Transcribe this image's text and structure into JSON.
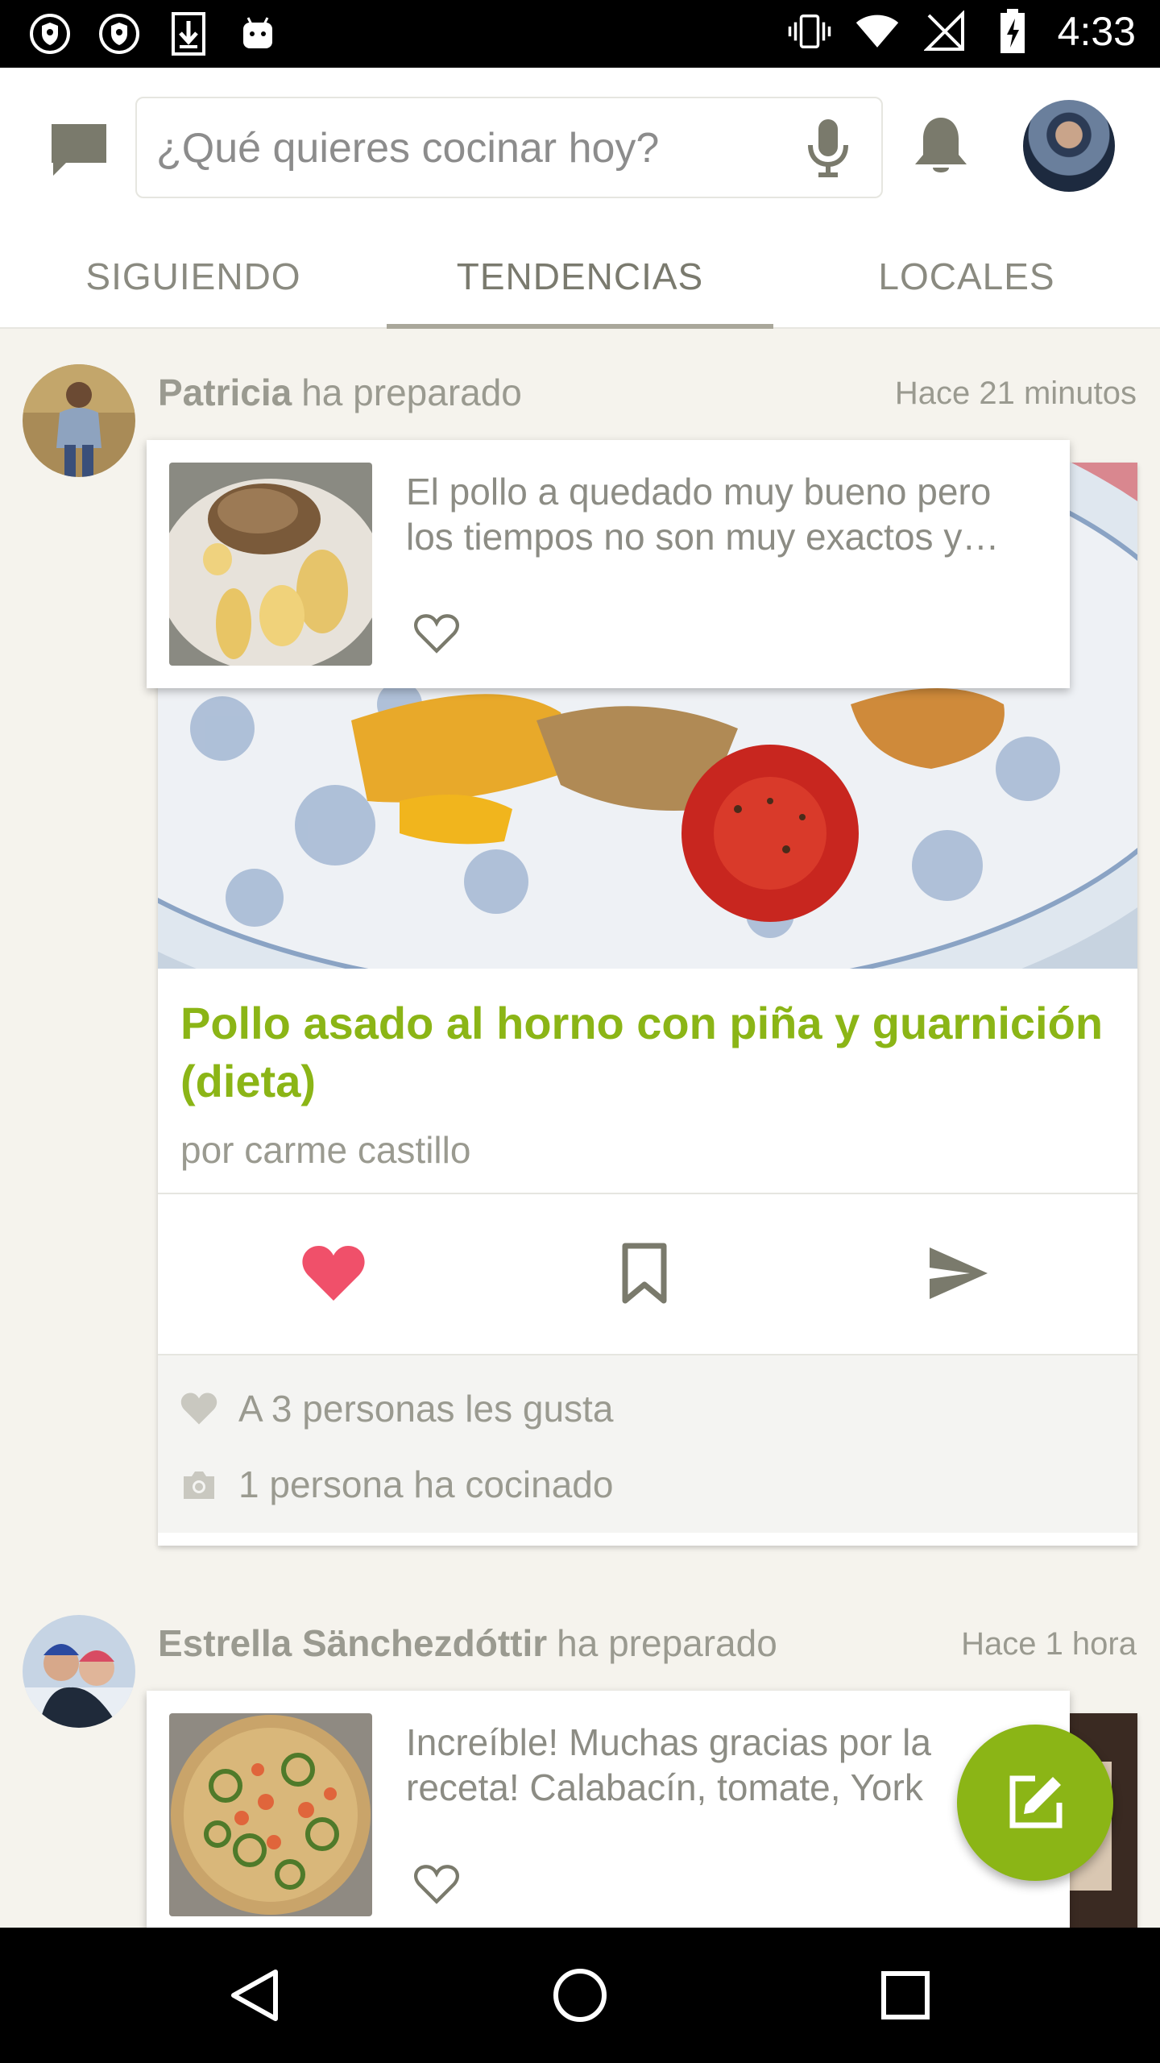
{
  "status_bar": {
    "time": "4:33",
    "left_icons": [
      "shield-icon",
      "shield-icon",
      "download-icon",
      "android-icon"
    ],
    "right_icons": [
      "vibrate-icon",
      "wifi-icon",
      "no-signal-icon",
      "battery-charging-icon"
    ]
  },
  "app_bar": {
    "search_placeholder": "¿Qué quieres cocinar hoy?",
    "icons": [
      "chat-icon",
      "mic-icon",
      "bell-icon"
    ]
  },
  "tabs": [
    {
      "label": "SIGUIENDO",
      "active": false
    },
    {
      "label": "TENDENCIAS",
      "active": true
    },
    {
      "label": "LOCALES",
      "active": false
    }
  ],
  "posts": [
    {
      "user": "Patricia",
      "verb": "ha preparado",
      "time": "Hace 21 minutos",
      "comment": "El pollo a quedado muy bueno pero los tiempos no son muy exactos y…",
      "recipe_title": "Pollo asado al horno con piña y guarnición  (dieta)",
      "recipe_author": "por carme castillo",
      "likes_text": "A 3 personas les gusta",
      "cooked_text": "1 persona ha cocinado",
      "liked": true
    },
    {
      "user": "Estrella Sänchezdóttir",
      "verb": "ha preparado",
      "time": "Hace 1 hora",
      "comment": "Increíble! Muchas gracias por la receta! Calabacín, tomate, York"
    }
  ],
  "colors": {
    "accent_green": "#8bb516",
    "like_red": "#f0506a",
    "background": "#f5f3ed"
  }
}
